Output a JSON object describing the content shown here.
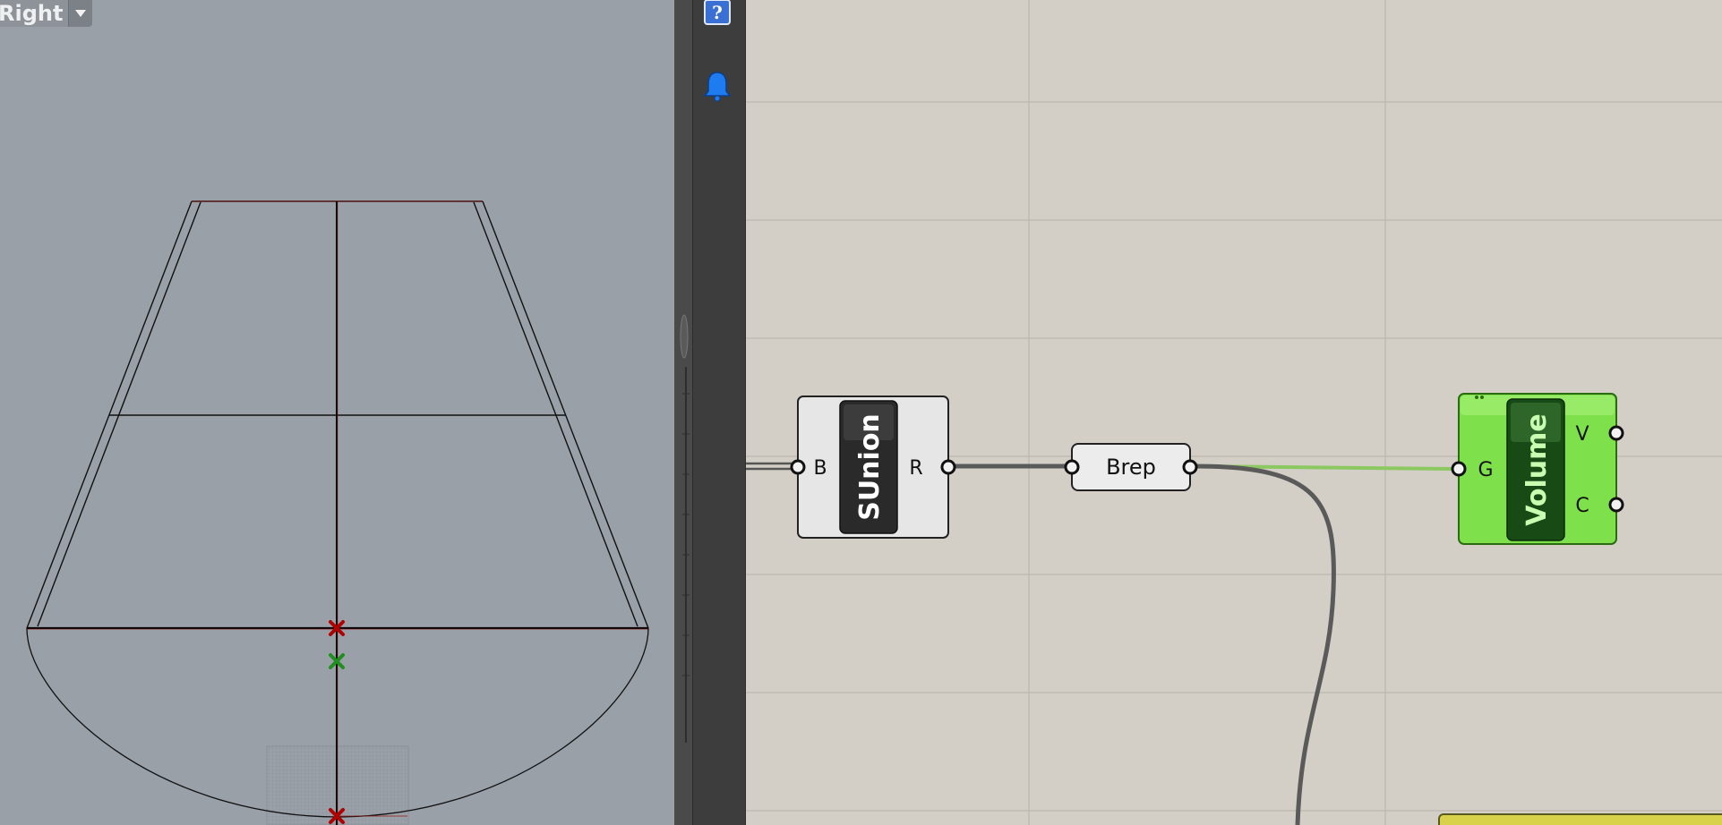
{
  "viewport": {
    "title": "Right",
    "dropdown_icon": "triangle-down-icon"
  },
  "sidebar": {
    "help_icon": "question-mark-icon",
    "notification_icon": "bell-icon"
  },
  "canvas": {
    "components": {
      "sunion": {
        "name": "SUnion",
        "input": "B",
        "output": "R"
      },
      "brep": {
        "name": "Brep"
      },
      "volume": {
        "name": "Volume",
        "input": "G",
        "outputs": [
          "V",
          "C"
        ]
      }
    }
  },
  "colors": {
    "viewport_bg": "#9aa0a8",
    "canvas_bg": "#d3cfc7",
    "volume_green": "#7ee04a",
    "wire_dark": "#5a5a5a",
    "wire_selected": "#8cc860",
    "point_red": "#b00000",
    "point_green": "#1f8f1f"
  }
}
